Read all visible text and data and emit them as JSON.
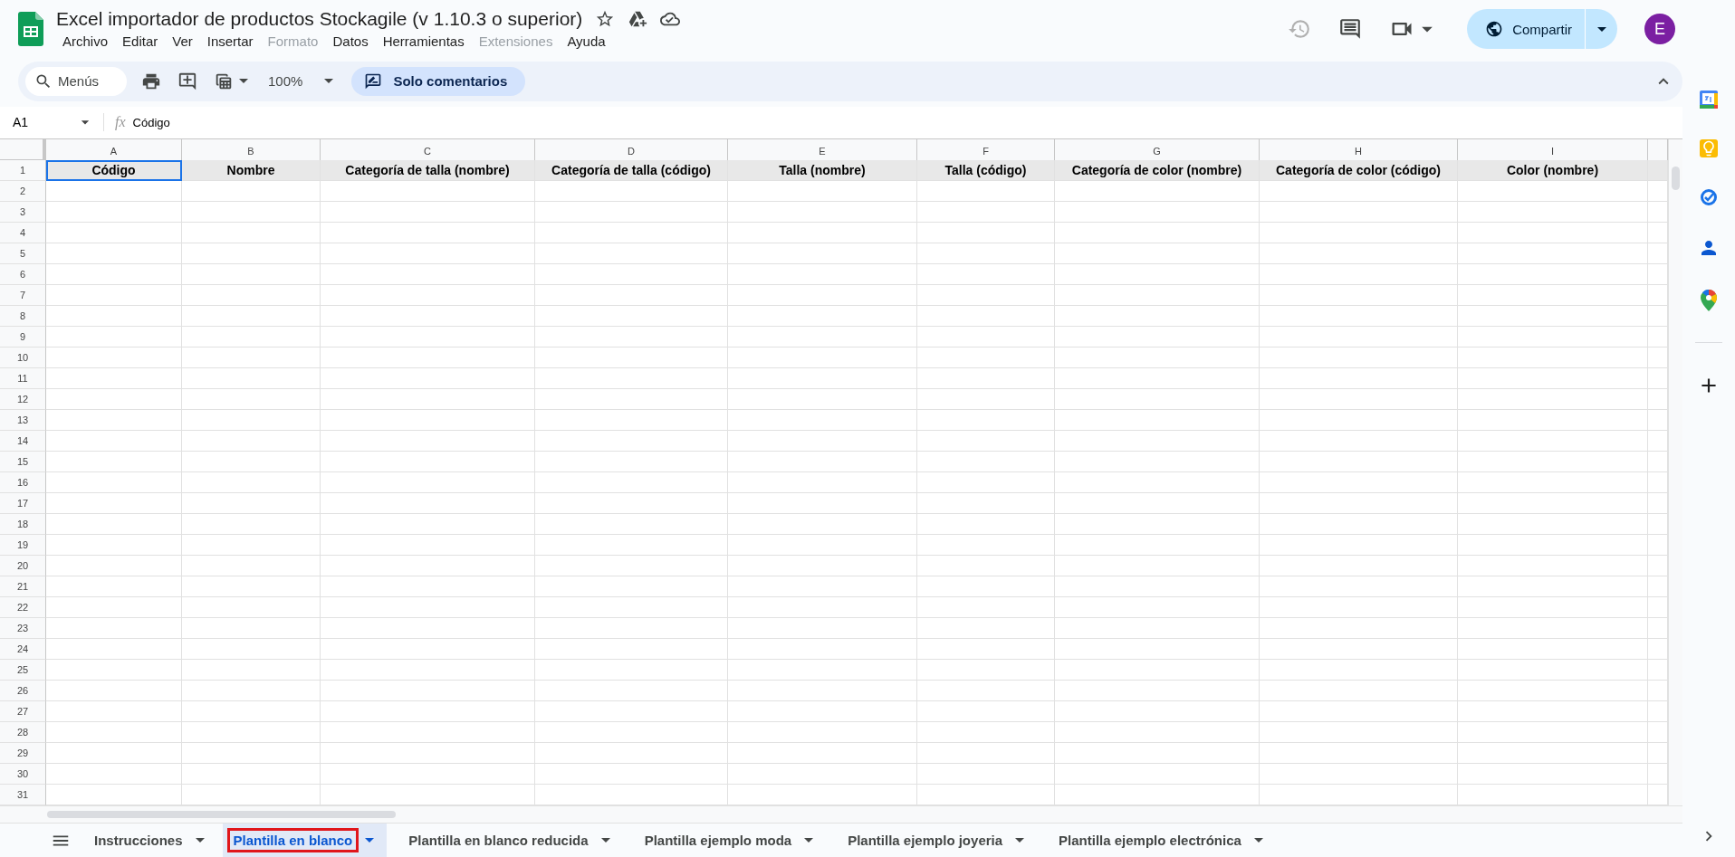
{
  "document": {
    "title": "Excel importador de productos Stockagile (v 1.10.3 o superior)"
  },
  "menu": [
    {
      "label": "Archivo",
      "disabled": false
    },
    {
      "label": "Editar",
      "disabled": false
    },
    {
      "label": "Ver",
      "disabled": false
    },
    {
      "label": "Insertar",
      "disabled": false
    },
    {
      "label": "Formato",
      "disabled": true
    },
    {
      "label": "Datos",
      "disabled": false
    },
    {
      "label": "Herramientas",
      "disabled": false
    },
    {
      "label": "Extensiones",
      "disabled": true
    },
    {
      "label": "Ayuda",
      "disabled": false
    }
  ],
  "share_button": {
    "label": "Compartir"
  },
  "avatar": {
    "initial": "E"
  },
  "toolbar": {
    "search": {
      "placeholder": "Menús"
    },
    "zoom": "100%",
    "mode_button": "Solo comentarios"
  },
  "formula_bar": {
    "cell_ref": "A1",
    "function_label": "fx",
    "value": "Código"
  },
  "sheet": {
    "columns": [
      "A",
      "B",
      "C",
      "D",
      "E",
      "F",
      "G",
      "H",
      "I"
    ],
    "header_cells": [
      {
        "text": "Código",
        "selected": true
      },
      {
        "text": "Nombre",
        "selected": false
      },
      {
        "text": "Categoría de talla (nombre)",
        "selected": false
      },
      {
        "text": "Categoría de talla (código)",
        "selected": false
      },
      {
        "text": "Talla (nombre)",
        "selected": false
      },
      {
        "text": "Talla (código)",
        "selected": false
      },
      {
        "text": "Categoría de color (nombre)",
        "selected": false
      },
      {
        "text": "Categoría de color (código)",
        "selected": false
      },
      {
        "text": "Color (nombre)",
        "selected": false
      }
    ],
    "row_numbers": [
      "1",
      "2",
      "3",
      "4",
      "5",
      "6",
      "7",
      "8",
      "9",
      "10",
      "11",
      "12",
      "13",
      "14",
      "15",
      "16",
      "17",
      "18",
      "19",
      "20",
      "21",
      "22",
      "23",
      "24",
      "25",
      "26",
      "27",
      "28",
      "29",
      "30",
      "31"
    ]
  },
  "sheet_tabs": [
    {
      "label": "Instrucciones",
      "selected": false,
      "highlighted": false
    },
    {
      "label": "Plantilla en blanco",
      "selected": true,
      "highlighted": true
    },
    {
      "label": "Plantilla en blanco reducida",
      "selected": false,
      "highlighted": false
    },
    {
      "label": "Plantilla ejemplo moda",
      "selected": false,
      "highlighted": false
    },
    {
      "label": "Plantilla ejemplo joyeria",
      "selected": false,
      "highlighted": false
    },
    {
      "label": "Plantilla ejemplo electrónica",
      "selected": false,
      "highlighted": false
    }
  ]
}
